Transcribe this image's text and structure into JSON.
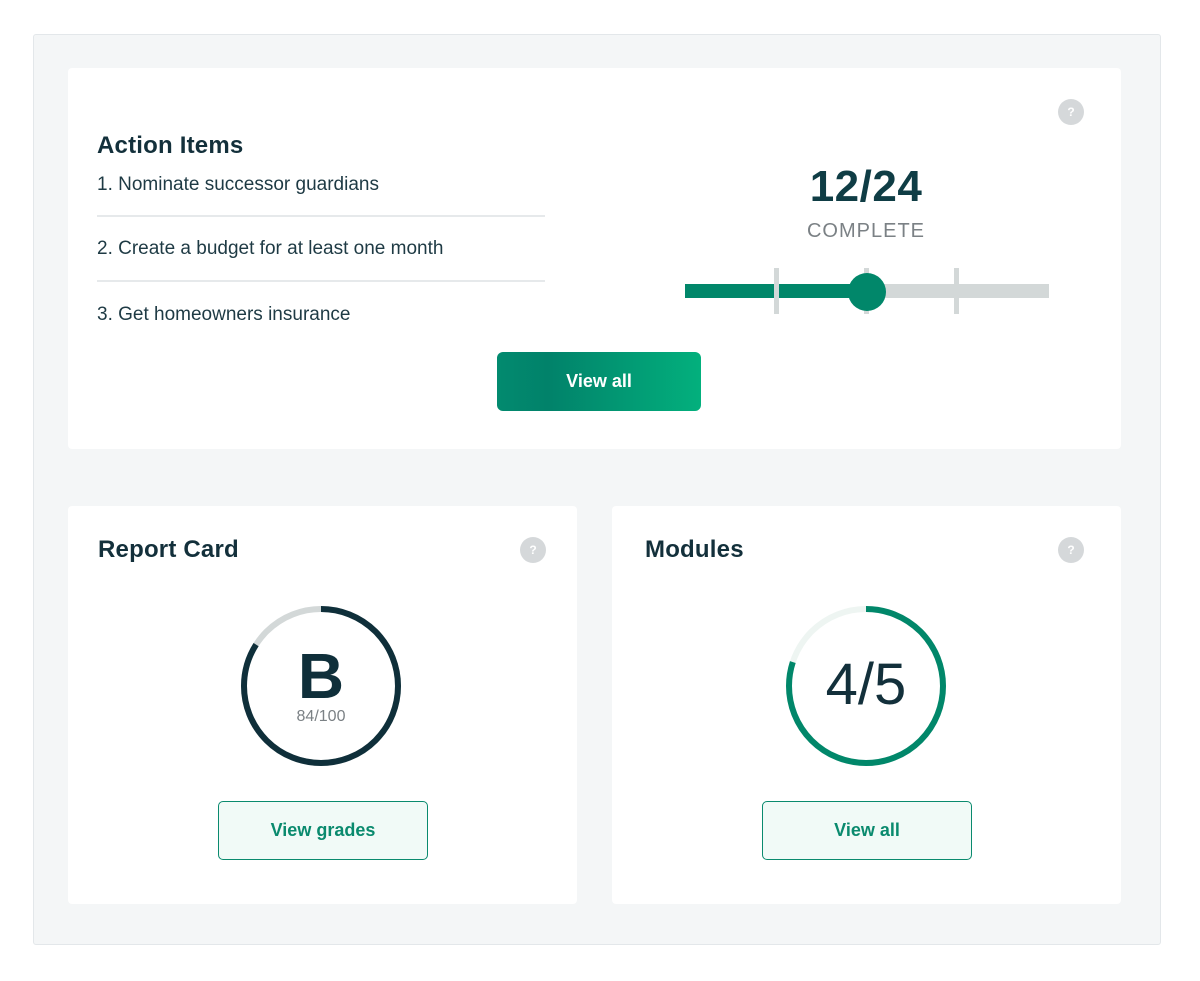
{
  "action_card": {
    "title": "Action Items",
    "help": "?",
    "items": [
      "1. Nominate successor guardians",
      "2. Create a budget for at least one month",
      "3. Get homeowners insurance"
    ],
    "progress": {
      "completed": 12,
      "total": 24,
      "count_text": "12/24",
      "label": "COMPLETE"
    },
    "view_all_label": "View all"
  },
  "report_card": {
    "title": "Report Card",
    "help": "?",
    "grade": "B",
    "score_text": "84/100",
    "score": 84,
    "max": 100,
    "button_label": "View grades"
  },
  "modules_card": {
    "title": "Modules",
    "help": "?",
    "count_text": "4/5",
    "completed": 4,
    "total": 5,
    "button_label": "View all"
  },
  "colors": {
    "accent": "#01876a",
    "dark": "#0f2f3a",
    "track": "#d3d8d8",
    "background": "#f4f6f7"
  }
}
